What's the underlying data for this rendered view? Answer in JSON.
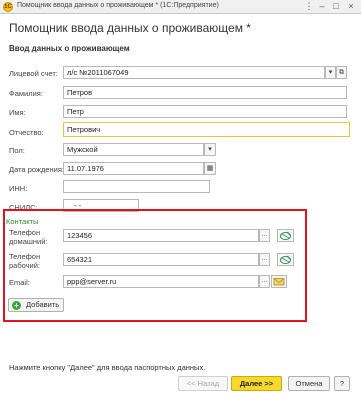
{
  "window": {
    "app_icon": "1C",
    "title": "Помощник ввода данных о проживающем * (1С:Предприятие)",
    "menu_icon": "⋮",
    "minimize_icon": "–",
    "maximize_icon": "□",
    "close_icon": "×"
  },
  "form": {
    "title": "Помощник ввода данных о проживающем *",
    "section_title": "Ввод данных о проживающем"
  },
  "fields": {
    "account": {
      "label": "Лицевой счет:",
      "value": "л/с №2011067049",
      "dropdown_icon": "▾",
      "open_icon": "⧉"
    },
    "lastname": {
      "label": "Фамилия:",
      "value": "Петров"
    },
    "firstname": {
      "label": "Имя:",
      "value": "Петр"
    },
    "middlename": {
      "label": "Отчество:",
      "value": "Петрович"
    },
    "gender": {
      "label": "Пол:",
      "value": "Мужской",
      "dropdown_icon": "▾"
    },
    "birthdate": {
      "label": "Дата рождения:",
      "value": "11.07.1976",
      "calendar_icon": "▦"
    },
    "inn": {
      "label": "ИНН:",
      "value": ""
    },
    "snils": {
      "label": "СНИЛС:",
      "value": "-   -"
    }
  },
  "contacts": {
    "title": "Контакты",
    "home_phone": {
      "label_line1": "Телефон",
      "label_line2": "домашний:",
      "value": "123456",
      "ellipsis": "..."
    },
    "work_phone": {
      "label_line1": "Телефон",
      "label_line2": "рабочий:",
      "value": "654321",
      "ellipsis": "..."
    },
    "email": {
      "label": "Email:",
      "value": "ppp@server.ru",
      "ellipsis": "..."
    },
    "add_button": {
      "icon": "+",
      "label": "Добавить"
    }
  },
  "footer": {
    "hint": "Нажмите кнопку \"Далее\" для ввода паспортных данных.",
    "back_button": "<< Назад",
    "next_button": "Далее >>",
    "cancel_button": "Отмена",
    "help_button": "?"
  },
  "colors": {
    "highlight_border": "#e0141e",
    "contacts_title": "#2e8b2e",
    "primary_button": "#f7d82c",
    "active_field_border": "#e8c43a"
  }
}
